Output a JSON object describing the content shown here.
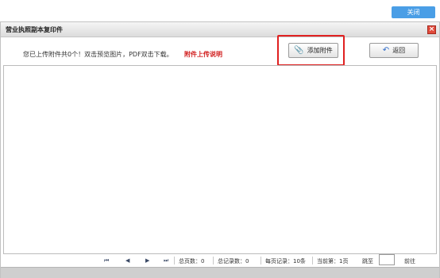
{
  "topbar": {
    "close_label": "关闭"
  },
  "dialog": {
    "title": "营业执照副本复印件",
    "info_text": "您已上传附件共0个！双击预览图片，PDF双击下载。",
    "info_link": "附件上传说明",
    "add_button": "添加附件",
    "back_button": "返回"
  },
  "pager": {
    "total_pages": "总页数：0",
    "total_records": "总记录数：0",
    "per_page": "每页记录：10条",
    "current_page": "当前第：1页",
    "jump_label": "跳至",
    "go_label": "前往",
    "jump_value": ""
  },
  "icons": {
    "first": "first-page-icon",
    "prev": "prev-page-icon",
    "next": "next-page-icon",
    "last": "last-page-icon"
  }
}
